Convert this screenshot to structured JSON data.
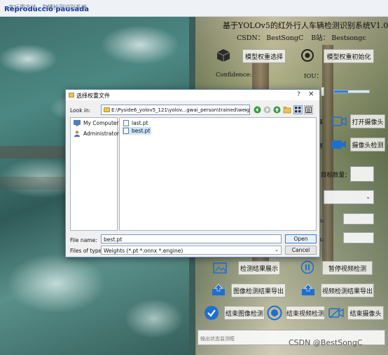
{
  "window": {
    "title": "高玩用方法 - 车辆检测识别系统",
    "overlay_text": "Reproducció pausada"
  },
  "panel": {
    "title": "基于YOLOv5的红外行人车辆检测识别系统V1.0",
    "csdn": "CSDN：  BestSongC",
    "bilibili": "B站：  Bestsongc",
    "btn_select_weights": "模型权重选择",
    "btn_init_weights": "模型权重初始化",
    "confidence_label": "Confidence:",
    "iou_label": "IOU：",
    "btn_open_camera": "打开摄像头",
    "btn_camera_detect": "摄像头检测",
    "target_count_label": "目标数量：",
    "btn_show_results": "检测结果展示",
    "btn_pause_video": "暂停视频检测",
    "btn_export_image": "图像检测结果导出",
    "btn_export_video": "视频检测结果导出",
    "btn_end_image": "结束图像检测",
    "btn_end_video": "结束视频检测",
    "btn_end_camera": "结束摄像头",
    "status_placeholder": "输出状态监测框",
    "partial_labels": [
      "頻",
      "测",
      "m:",
      "ax:"
    ]
  },
  "watermark": "CSDN @BestSongC",
  "dialog": {
    "title": "选择权重文件",
    "help": "?",
    "close": "✕",
    "look_in_label": "Look in:",
    "look_in_path": "E:\\Pyside6_yolov5_121\\yolov...gwai_person\\trained\\weights",
    "places": [
      "My Computer",
      "Administrator"
    ],
    "files": [
      {
        "name": "last.pt",
        "selected": false
      },
      {
        "name": "best.pt",
        "selected": true
      }
    ],
    "file_name_label": "File name:",
    "file_name_value": "best.pt",
    "file_type_label": "Files of type:",
    "file_type_value": "Weights (*.pt *.onnx *.engine)",
    "open_label": "Open",
    "cancel_label": "Cancel"
  },
  "colors": {
    "overlay_text": "#1c3a9e",
    "icon_blue": "#1f6fd1",
    "selection": "#cce4f7"
  }
}
